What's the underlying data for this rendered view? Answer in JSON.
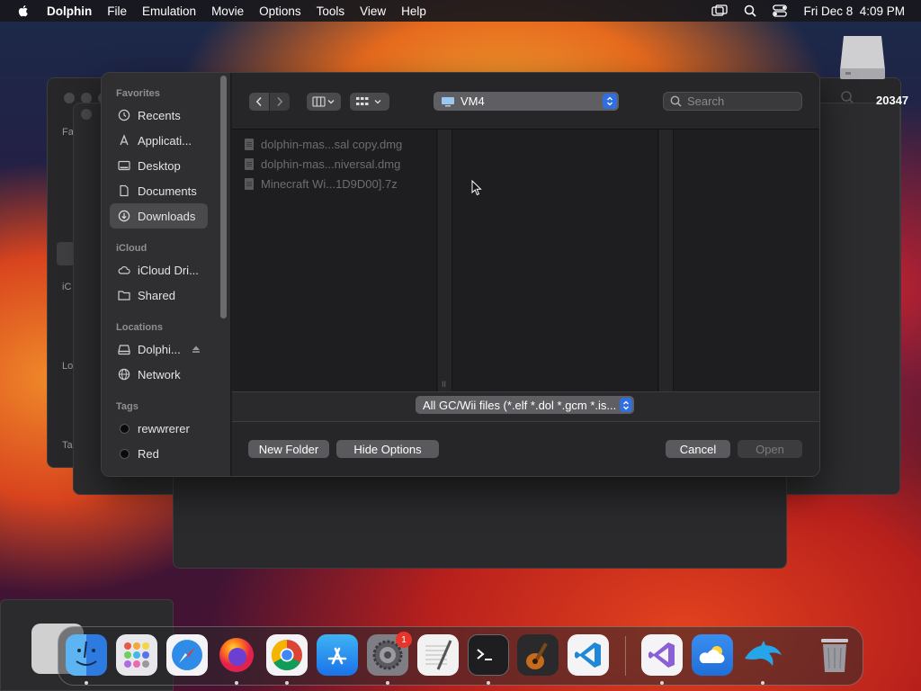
{
  "menubar": {
    "app_name": "Dolphin",
    "items": [
      "File",
      "Emulation",
      "Movie",
      "Options",
      "Tools",
      "View",
      "Help"
    ],
    "clock": "Fri Dec 8  4:09 PM"
  },
  "background_windows": {
    "labels": [
      "Fa",
      "iC",
      "Lo",
      "Ta"
    ],
    "number": "20347"
  },
  "dialog": {
    "sidebar": {
      "favorites_header": "Favorites",
      "favorites": [
        {
          "label": "Recents",
          "icon": "clock-icon"
        },
        {
          "label": "Applicati...",
          "icon": "applications-icon"
        },
        {
          "label": "Desktop",
          "icon": "desktop-icon"
        },
        {
          "label": "Documents",
          "icon": "document-icon"
        },
        {
          "label": "Downloads",
          "icon": "download-icon",
          "selected": true
        }
      ],
      "icloud_header": "iCloud",
      "icloud": [
        {
          "label": "iCloud Dri...",
          "icon": "cloud-icon"
        },
        {
          "label": "Shared",
          "icon": "shared-folder-icon"
        }
      ],
      "locations_header": "Locations",
      "locations": [
        {
          "label": "Dolphi...",
          "icon": "disk-icon"
        },
        {
          "label": "Network",
          "icon": "globe-icon"
        }
      ],
      "tags_header": "Tags",
      "tags": [
        {
          "label": "rewwrerer"
        },
        {
          "label": "Red"
        }
      ]
    },
    "path_popup": {
      "label": "VM4"
    },
    "search": {
      "placeholder": "Search"
    },
    "files": [
      "dolphin-mas...sal copy.dmg",
      "dolphin-mas...niversal.dmg",
      "Minecraft Wi...1D9D00].7z"
    ],
    "filter": {
      "label": "All GC/Wii files (*.elf *.dol *.gcm *.is..."
    },
    "buttons": {
      "new_folder": "New Folder",
      "hide_options": "Hide Options",
      "cancel": "Cancel",
      "open": "Open"
    }
  },
  "dock": {
    "apps": [
      "finder-icon",
      "launchpad-icon",
      "safari-icon",
      "firefox-icon",
      "chrome-icon",
      "app-store-icon",
      "system-settings-icon",
      "textedit-icon",
      "terminal-icon",
      "garageband-icon",
      "vscode-icon",
      "visual-studio-icon",
      "weather-icon",
      "dolphin-icon",
      "trash-icon"
    ],
    "settings_badge": "1"
  },
  "colors": {
    "accent": "#2f6fe0",
    "badge": "#e8352c"
  }
}
